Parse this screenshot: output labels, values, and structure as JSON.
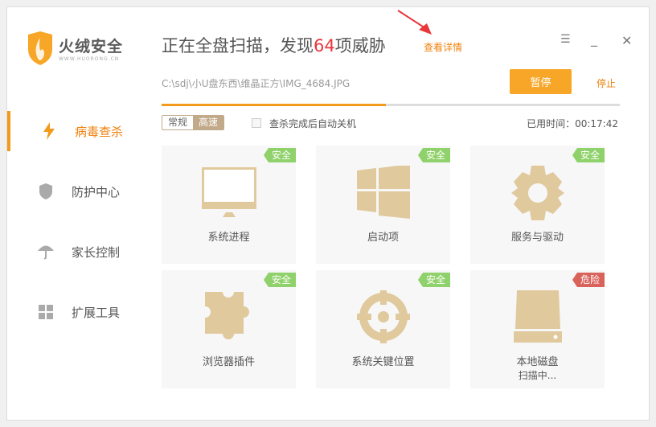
{
  "app": {
    "name": "火绒安全",
    "url": "WWW.HUORONG.CN"
  },
  "sidebar": {
    "items": [
      {
        "label": "病毒查杀",
        "icon": "lightning-icon",
        "active": true
      },
      {
        "label": "防护中心",
        "icon": "shield-icon"
      },
      {
        "label": "家长控制",
        "icon": "umbrella-icon"
      },
      {
        "label": "扩展工具",
        "icon": "grid-icon"
      }
    ]
  },
  "header": {
    "title_prefix": "正在全盘扫描，发现",
    "threat_count": "64",
    "title_suffix": "项威胁",
    "detail_link": "查看详情"
  },
  "scan": {
    "current_path": "C:\\sdj\\小U盘东西\\维晶正方\\IMG_4684.JPG",
    "pause_label": "暂停",
    "stop_label": "停止",
    "progress_percent": 49,
    "mode_options": [
      "常规",
      "高速"
    ],
    "mode_selected": "高速",
    "auto_shutdown_label": "查杀完成后自动关机",
    "auto_shutdown_checked": false,
    "elapsed_label": "已用时间：",
    "elapsed": "00:17:42"
  },
  "colors": {
    "accent": "#f19a1b",
    "safe": "#8fd16a",
    "danger": "#d9625b",
    "icon": "#e0c99c"
  },
  "cards": [
    {
      "label": "系统进程",
      "status": "安全",
      "icon": "monitor-icon"
    },
    {
      "label": "启动项",
      "status": "安全",
      "icon": "windows-icon"
    },
    {
      "label": "服务与驱动",
      "status": "安全",
      "icon": "gear-icon"
    },
    {
      "label": "浏览器插件",
      "status": "安全",
      "icon": "puzzle-icon"
    },
    {
      "label": "系统关键位置",
      "status": "安全",
      "icon": "target-icon"
    },
    {
      "label": "本地磁盘",
      "status": "危险",
      "icon": "disk-icon",
      "sub": "扫描中..."
    }
  ]
}
